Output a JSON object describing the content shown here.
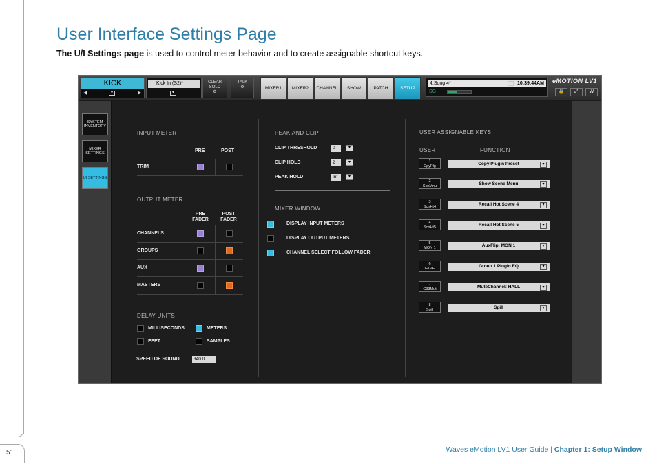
{
  "page": {
    "title": "User Interface Settings Page",
    "intro_bold": "The U/I Settings page",
    "intro_rest": " is used to control meter behavior and to create assignable shortcut keys.",
    "page_number": "51",
    "footer_guide": "Waves eMotion LV1 User Guide | ",
    "footer_chapter": "Chapter 1: Setup Window"
  },
  "topbar": {
    "channel_name": "KICK",
    "channel_input": "Kick In (S2)*",
    "clear_solo": "CLEAR SOLO",
    "talk": "TALK",
    "tabs": [
      "MIXER1",
      "MIXER2",
      "CHANNEL",
      "SHOW",
      "PATCH",
      "SETUP"
    ],
    "song": "4:Song 4*",
    "time": "10:39:44AM",
    "sg": "SG",
    "logo": "eMOTION LV1"
  },
  "sidebar": {
    "items": [
      "SYSTEM INVENTORY",
      "MIXER SETTINGS",
      "UI SETTINGS"
    ]
  },
  "input_meter": {
    "heading": "INPUT METER",
    "col_pre": "PRE",
    "col_post": "POST",
    "trim": "TRIM"
  },
  "output_meter": {
    "heading": "OUTPUT METER",
    "col_pre": "PRE FADER",
    "col_post": "POST FADER",
    "rows": [
      "CHANNELS",
      "GROUPS",
      "AUX",
      "MASTERS"
    ]
  },
  "delay_units": {
    "heading": "DELAY UNITS",
    "milliseconds": "MILLISECONDS",
    "meters": "METERS",
    "feet": "FEET",
    "samples": "SAMPLES",
    "speed_label": "SPEED OF SOUND",
    "speed_value": "340.0"
  },
  "peak_clip": {
    "heading": "PEAK AND CLIP",
    "clip_threshold": "CLIP THRESHOLD",
    "clip_threshold_value": "0",
    "clip_hold": "CLIP HOLD",
    "clip_hold_value": "2",
    "peak_hold": "PEAK HOLD",
    "peak_hold_value": "Inf"
  },
  "mixer_window": {
    "heading": "MIXER WINDOW",
    "display_input": "DISPLAY INPUT METERS",
    "display_output": "DISPLAY OUTPUT METERS",
    "channel_select": "CHANNEL SELECT FOLLOW FADER"
  },
  "keys": {
    "heading": "USER ASSIGNABLE KEYS",
    "col_user": "USER",
    "col_function": "FUNCTION",
    "items": [
      {
        "num": "1",
        "short": "CpyPlg",
        "func": "Copy Plugin Preset"
      },
      {
        "num": "2",
        "short": "ScnMnu",
        "func": "Show Scene Menu"
      },
      {
        "num": "3",
        "short": "ScnHt4",
        "func": "Recall Hot Scene 4"
      },
      {
        "num": "4",
        "short": "ScnHt5",
        "func": "Recall Hot Scene 5"
      },
      {
        "num": "5",
        "short": "MON 1",
        "func": "AuxFlip: MON 1"
      },
      {
        "num": "6",
        "short": "G1PE",
        "func": "Group 1 Plugin EQ"
      },
      {
        "num": "7",
        "short": "C33Mut",
        "func": "MuteChannel: HALL"
      },
      {
        "num": "8",
        "short": "Spill",
        "func": "Spill"
      }
    ]
  }
}
